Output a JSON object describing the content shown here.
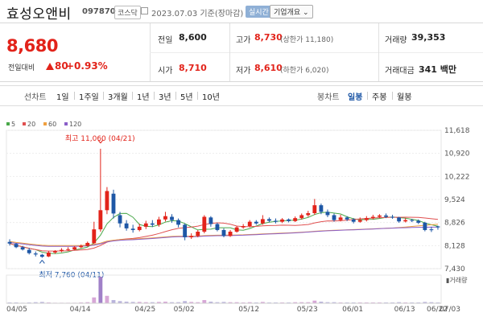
{
  "header": {
    "stock_name": "효성오앤비",
    "stock_code": "097870",
    "market_badge": "코스닥",
    "date_text": "2023.07.03 기준(장마감)",
    "live_button": "실시간",
    "corp_button": "기업개요 ⌄"
  },
  "quote": {
    "price": "8,680",
    "change_label": "전일대비",
    "change_value": "80",
    "change_pct": "+0.93%",
    "prev_close_label": "전일",
    "prev_close": "8,600",
    "high_label": "고가",
    "high": "8,730",
    "upper_limit_note": "(상한가 11,180)",
    "volume_label": "거래량",
    "volume": "39,353",
    "open_label": "시가",
    "open": "8,710",
    "low_label": "저가",
    "low": "8,610",
    "lower_limit_note": "(하한가 6,020)",
    "amount_label": "거래대금",
    "amount": "341 백만",
    "up_color": "#e2231a",
    "down_color": "#1e57a6"
  },
  "toolbar": {
    "line_chart_label": "선차트",
    "periods": [
      "1일",
      "1주일",
      "3개월",
      "1년",
      "3년",
      "5년",
      "10년"
    ],
    "candle_chart_label": "봉차트",
    "candle_periods": [
      "일봉",
      "주봉",
      "월봉"
    ],
    "candle_active": "일봉"
  },
  "chart_data": {
    "type": "candlestick",
    "legend": [
      {
        "name": "5",
        "color": "#4aa84a"
      },
      {
        "name": "20",
        "color": "#e05050"
      },
      {
        "name": "60",
        "color": "#f0a040"
      },
      {
        "name": "120",
        "color": "#8a5ec8"
      }
    ],
    "y_ticks": [
      "11,618",
      "10,920",
      "10,222",
      "9,524",
      "8,826",
      "8,128",
      "7,430"
    ],
    "ylim": [
      7430,
      11618
    ],
    "x_ticks": [
      "04/05",
      "04/14",
      "04/25",
      "05/02",
      "05/12",
      "05/23",
      "06/01",
      "06/13",
      "06/22",
      "07/03"
    ],
    "max_annotation": "최고 11,060 (04/21)",
    "min_annotation": "최저 7,760 (04/11)",
    "volume_label": "거래량",
    "candles": [
      {
        "o": 8240,
        "c": 8190,
        "h": 8320,
        "l": 8130
      },
      {
        "o": 8180,
        "c": 8080,
        "h": 8210,
        "l": 8050
      },
      {
        "o": 8080,
        "c": 8010,
        "h": 8120,
        "l": 7980
      },
      {
        "o": 8000,
        "c": 7900,
        "h": 8060,
        "l": 7860
      },
      {
        "o": 7890,
        "c": 7860,
        "h": 7950,
        "l": 7800
      },
      {
        "o": 7850,
        "c": 7790,
        "h": 7880,
        "l": 7760
      },
      {
        "o": 7800,
        "c": 7920,
        "h": 7960,
        "l": 7780
      },
      {
        "o": 7920,
        "c": 7960,
        "h": 7990,
        "l": 7880
      },
      {
        "o": 7960,
        "c": 8000,
        "h": 8050,
        "l": 7930
      },
      {
        "o": 8000,
        "c": 8020,
        "h": 8080,
        "l": 7970
      },
      {
        "o": 8010,
        "c": 8080,
        "h": 8110,
        "l": 7990
      },
      {
        "o": 8080,
        "c": 8120,
        "h": 8160,
        "l": 8050
      },
      {
        "o": 8120,
        "c": 8210,
        "h": 8250,
        "l": 8100
      },
      {
        "o": 8200,
        "c": 8620,
        "h": 8850,
        "l": 8180
      },
      {
        "o": 8620,
        "c": 9200,
        "h": 11060,
        "l": 8550
      },
      {
        "o": 9200,
        "c": 9780,
        "h": 9900,
        "l": 9080
      },
      {
        "o": 9700,
        "c": 9100,
        "h": 9820,
        "l": 8950
      },
      {
        "o": 9050,
        "c": 8800,
        "h": 9150,
        "l": 8680
      },
      {
        "o": 8800,
        "c": 8650,
        "h": 8900,
        "l": 8580
      },
      {
        "o": 8640,
        "c": 8600,
        "h": 8760,
        "l": 8520
      },
      {
        "o": 8600,
        "c": 8700,
        "h": 8790,
        "l": 8560
      },
      {
        "o": 8700,
        "c": 8800,
        "h": 8880,
        "l": 8630
      },
      {
        "o": 8800,
        "c": 8760,
        "h": 8900,
        "l": 8690
      },
      {
        "o": 8760,
        "c": 8920,
        "h": 9000,
        "l": 8700
      },
      {
        "o": 8920,
        "c": 9020,
        "h": 9150,
        "l": 8860
      },
      {
        "o": 9000,
        "c": 8900,
        "h": 9080,
        "l": 8820
      },
      {
        "o": 8900,
        "c": 8760,
        "h": 8950,
        "l": 8680
      },
      {
        "o": 8760,
        "c": 8380,
        "h": 8800,
        "l": 8290
      },
      {
        "o": 8380,
        "c": 8420,
        "h": 8500,
        "l": 8330
      },
      {
        "o": 8420,
        "c": 8550,
        "h": 8600,
        "l": 8380
      },
      {
        "o": 8550,
        "c": 9000,
        "h": 9050,
        "l": 8500
      },
      {
        "o": 8980,
        "c": 8780,
        "h": 9020,
        "l": 8700
      },
      {
        "o": 8780,
        "c": 8600,
        "h": 8820,
        "l": 8560
      },
      {
        "o": 8600,
        "c": 8420,
        "h": 8650,
        "l": 8380
      },
      {
        "o": 8420,
        "c": 8550,
        "h": 8600,
        "l": 8390
      },
      {
        "o": 8550,
        "c": 8680,
        "h": 8720,
        "l": 8520
      },
      {
        "o": 8680,
        "c": 8720,
        "h": 8780,
        "l": 8640
      },
      {
        "o": 8720,
        "c": 8850,
        "h": 8900,
        "l": 8680
      },
      {
        "o": 8850,
        "c": 8800,
        "h": 8900,
        "l": 8760
      },
      {
        "o": 8800,
        "c": 8930,
        "h": 9050,
        "l": 8760
      },
      {
        "o": 8930,
        "c": 8880,
        "h": 8980,
        "l": 8830
      },
      {
        "o": 8880,
        "c": 8850,
        "h": 8950,
        "l": 8800
      },
      {
        "o": 8850,
        "c": 8920,
        "h": 8960,
        "l": 8810
      },
      {
        "o": 8920,
        "c": 8870,
        "h": 8950,
        "l": 8830
      },
      {
        "o": 8870,
        "c": 8960,
        "h": 9010,
        "l": 8840
      },
      {
        "o": 8960,
        "c": 9050,
        "h": 9100,
        "l": 8920
      },
      {
        "o": 9050,
        "c": 9110,
        "h": 9180,
        "l": 9000
      },
      {
        "o": 9110,
        "c": 9350,
        "h": 9540,
        "l": 9060
      },
      {
        "o": 9350,
        "c": 9150,
        "h": 9400,
        "l": 9080
      },
      {
        "o": 9150,
        "c": 9050,
        "h": 9220,
        "l": 8990
      },
      {
        "o": 9050,
        "c": 8900,
        "h": 9100,
        "l": 8850
      },
      {
        "o": 8900,
        "c": 8980,
        "h": 9060,
        "l": 8860
      },
      {
        "o": 8980,
        "c": 8920,
        "h": 9020,
        "l": 8870
      },
      {
        "o": 8920,
        "c": 8850,
        "h": 8960,
        "l": 8800
      },
      {
        "o": 8850,
        "c": 8900,
        "h": 8980,
        "l": 8820
      },
      {
        "o": 8900,
        "c": 8960,
        "h": 9020,
        "l": 8860
      },
      {
        "o": 8960,
        "c": 9000,
        "h": 9060,
        "l": 8920
      },
      {
        "o": 9000,
        "c": 9040,
        "h": 9080,
        "l": 8960
      },
      {
        "o": 9040,
        "c": 9000,
        "h": 9100,
        "l": 8960
      },
      {
        "o": 9000,
        "c": 8980,
        "h": 9060,
        "l": 8940
      },
      {
        "o": 8980,
        "c": 8860,
        "h": 9000,
        "l": 8820
      },
      {
        "o": 8860,
        "c": 8900,
        "h": 8960,
        "l": 8830
      },
      {
        "o": 8900,
        "c": 8880,
        "h": 8940,
        "l": 8840
      },
      {
        "o": 8880,
        "c": 8820,
        "h": 8920,
        "l": 8780
      },
      {
        "o": 8820,
        "c": 8600,
        "h": 8850,
        "l": 8560
      },
      {
        "o": 8620,
        "c": 8600,
        "h": 8700,
        "l": 8540
      },
      {
        "o": 8710,
        "c": 8680,
        "h": 8730,
        "l": 8610
      }
    ],
    "volumes": [
      0.03,
      0.03,
      0.02,
      0.03,
      0.04,
      0.05,
      0.03,
      0.02,
      0.02,
      0.02,
      0.02,
      0.03,
      0.04,
      0.22,
      1.0,
      0.28,
      0.12,
      0.08,
      0.06,
      0.05,
      0.05,
      0.04,
      0.04,
      0.05,
      0.06,
      0.04,
      0.04,
      0.08,
      0.05,
      0.04,
      0.12,
      0.06,
      0.04,
      0.05,
      0.04,
      0.04,
      0.03,
      0.04,
      0.03,
      0.05,
      0.03,
      0.03,
      0.03,
      0.03,
      0.04,
      0.04,
      0.04,
      0.1,
      0.06,
      0.04,
      0.04,
      0.03,
      0.03,
      0.03,
      0.03,
      0.03,
      0.03,
      0.03,
      0.03,
      0.03,
      0.04,
      0.03,
      0.03,
      0.03,
      0.05,
      0.04,
      0.03
    ]
  }
}
